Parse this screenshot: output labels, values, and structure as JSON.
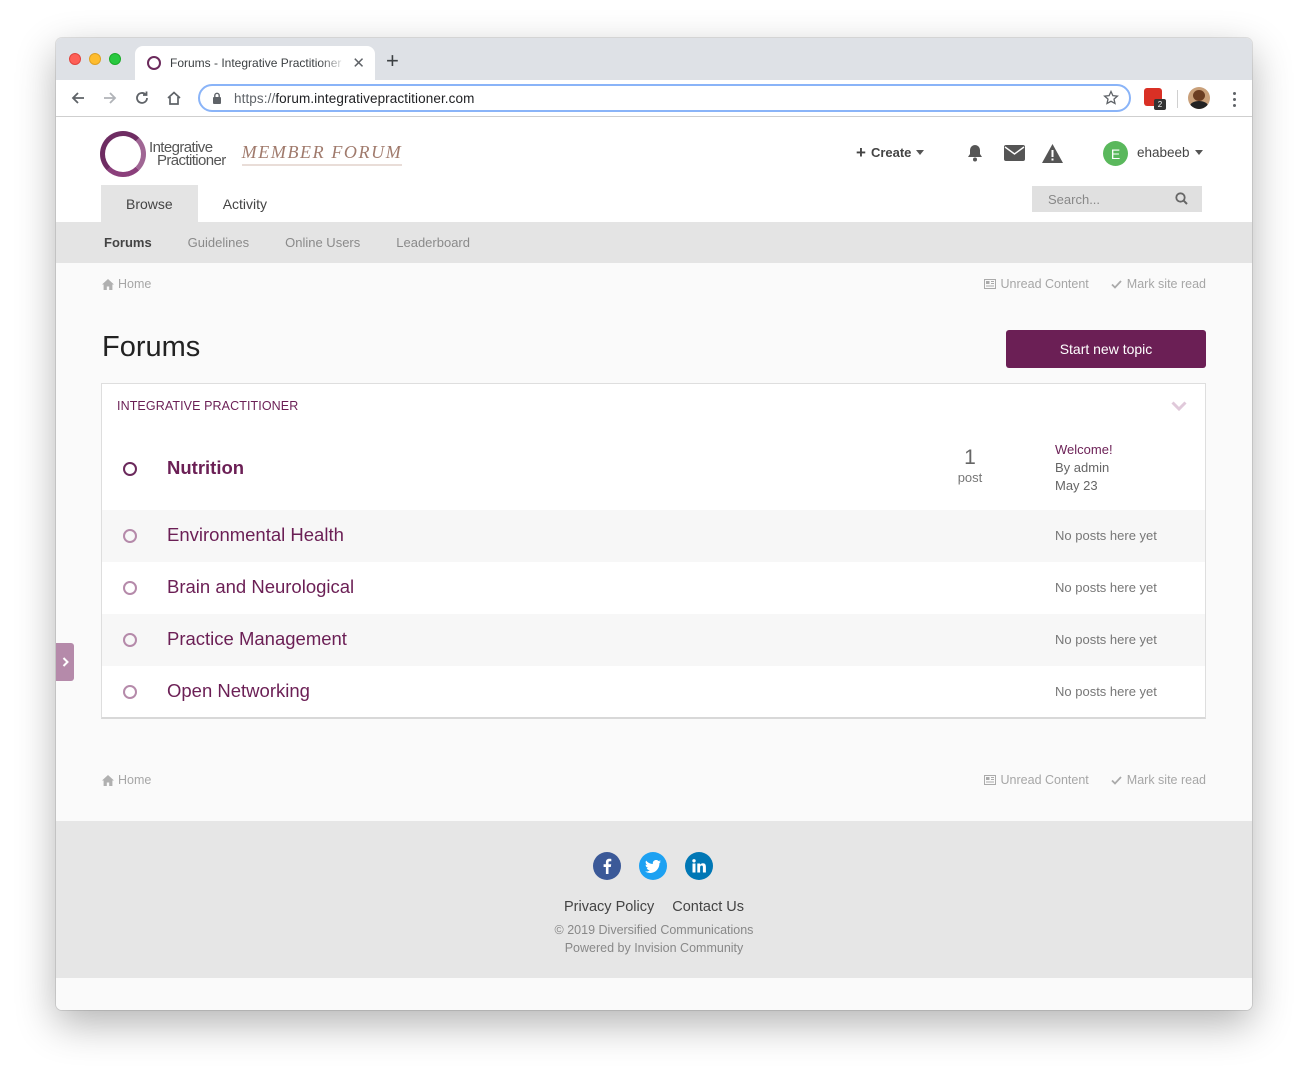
{
  "browser": {
    "tab_title": "Forums - Integrative Practitioner",
    "url_scheme": "https://",
    "url_host": "forum.integrativepractitioner.com",
    "extension_badge": "2"
  },
  "site": {
    "logo_line1": "Integrative",
    "logo_line2": "Practitioner",
    "logo_tagline": "MEMBER FORUM",
    "create_label": "Create",
    "user_initial": "E",
    "user_name": "ehabeeb",
    "user_avatar_color": "#5ab85c",
    "accent_color": "#6b1f55"
  },
  "primary_nav": {
    "browse": "Browse",
    "activity": "Activity"
  },
  "search": {
    "placeholder": "Search..."
  },
  "secondary_nav": {
    "forums": "Forums",
    "guidelines": "Guidelines",
    "online_users": "Online Users",
    "leaderboard": "Leaderboard"
  },
  "breadcrumb": {
    "home": "Home",
    "unread_content": "Unread Content",
    "mark_site_read": "Mark site read"
  },
  "page": {
    "title": "Forums",
    "start_topic": "Start new topic"
  },
  "category": {
    "name": "INTEGRATIVE PRACTITIONER",
    "forums": [
      {
        "title": "Nutrition",
        "post_count": "1",
        "post_label": "post",
        "last_post_title": "Welcome!",
        "last_post_by": "By admin",
        "last_post_date": "May 23"
      },
      {
        "title": "Environmental Health",
        "status": "No posts here yet"
      },
      {
        "title": "Brain and Neurological",
        "status": "No posts here yet"
      },
      {
        "title": "Practice Management",
        "status": "No posts here yet"
      },
      {
        "title": "Open Networking",
        "status": "No posts here yet"
      }
    ]
  },
  "footer": {
    "privacy": "Privacy Policy",
    "contact": "Contact Us",
    "copyright": "© 2019 Diversified Communications",
    "powered": "Powered by Invision Community",
    "facebook_color": "#3b5998",
    "twitter_color": "#1da1f2",
    "linkedin_color": "#0077b5"
  }
}
